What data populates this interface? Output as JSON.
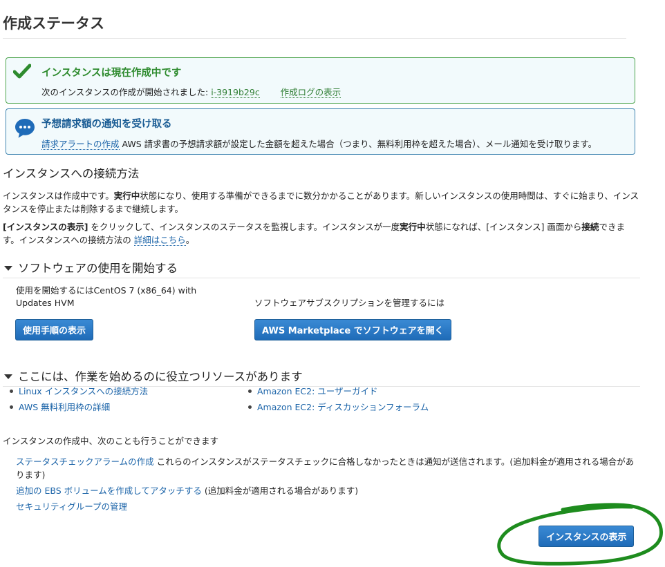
{
  "page": {
    "title": "作成ステータス"
  },
  "success_alert": {
    "title": "インスタンスは現在作成中です",
    "body_prefix": "次のインスタンスの作成が開始されました: ",
    "instance_id": "i-3919b29c",
    "log_link": "作成ログの表示"
  },
  "billing_alert": {
    "title": "予想請求額の通知を受け取る",
    "link": "請求アラートの作成",
    "body": " AWS 請求書の予想請求額が設定した金額を超えた場合（つまり、無料利用枠を超えた場合）、メール通知を受け取ります。"
  },
  "connect": {
    "heading": "インスタンスへの接続方法",
    "p1_a": "インスタンスは作成中です。",
    "p1_b": "実行中",
    "p1_c": "状態になり、使用する準備ができるまでに数分かかることがあります。新しいインスタンスの使用時間は、すぐに始まり、インスタンスを停止または削除するまで継続します。",
    "p2_a": "[インスタンスの表示]",
    "p2_b": " をクリックして、インスタンスのステータスを監視します。インスタンスが一度",
    "p2_c": "実行中",
    "p2_d": "状態になれば、[インスタンス] 画面から",
    "p2_e": "接続",
    "p2_f": "できます。インスタンスへの接続方法の ",
    "p2_link": "詳細はこちら",
    "p2_end": "。"
  },
  "software": {
    "heading": "ソフトウェアの使用を開始する",
    "left_text_line1": "使用を開始するにはCentOS 7 (x86_64) with",
    "left_text_line2": "Updates HVM",
    "left_button": "使用手順の表示",
    "right_text": "ソフトウェアサブスクリプションを管理するには",
    "right_button": "AWS Marketplace でソフトウェアを開く"
  },
  "resources": {
    "heading": "ここには、作業を始めるのに役立つリソースがあります",
    "left": [
      "Linux インスタンスへの接続方法",
      "AWS 無料利用枠の詳細"
    ],
    "right": [
      "Amazon EC2: ユーザーガイド",
      "Amazon EC2: ディスカッションフォーラム"
    ]
  },
  "also": {
    "label": "インスタンスの作成中、次のことも行うことができます",
    "item1_link": "ステータスチェックアラームの作成",
    "item1_text": " これらのインスタンスがステータスチェックに合格しなかったときは通知が送信されます。(追加料金が適用される場合があります)",
    "item2_link": "追加の EBS ボリュームを作成してアタッチする",
    "item2_text": " (追加料金が適用される場合があります)",
    "item3_link": "セキュリティグループの管理"
  },
  "footer": {
    "view_instances_button": "インスタンスの表示"
  },
  "colors": {
    "success": "#2e8b2e",
    "info": "#1a5c94",
    "link": "#1a63a8",
    "button": "#1f6bb8",
    "annotation": "#1e8c1e"
  }
}
